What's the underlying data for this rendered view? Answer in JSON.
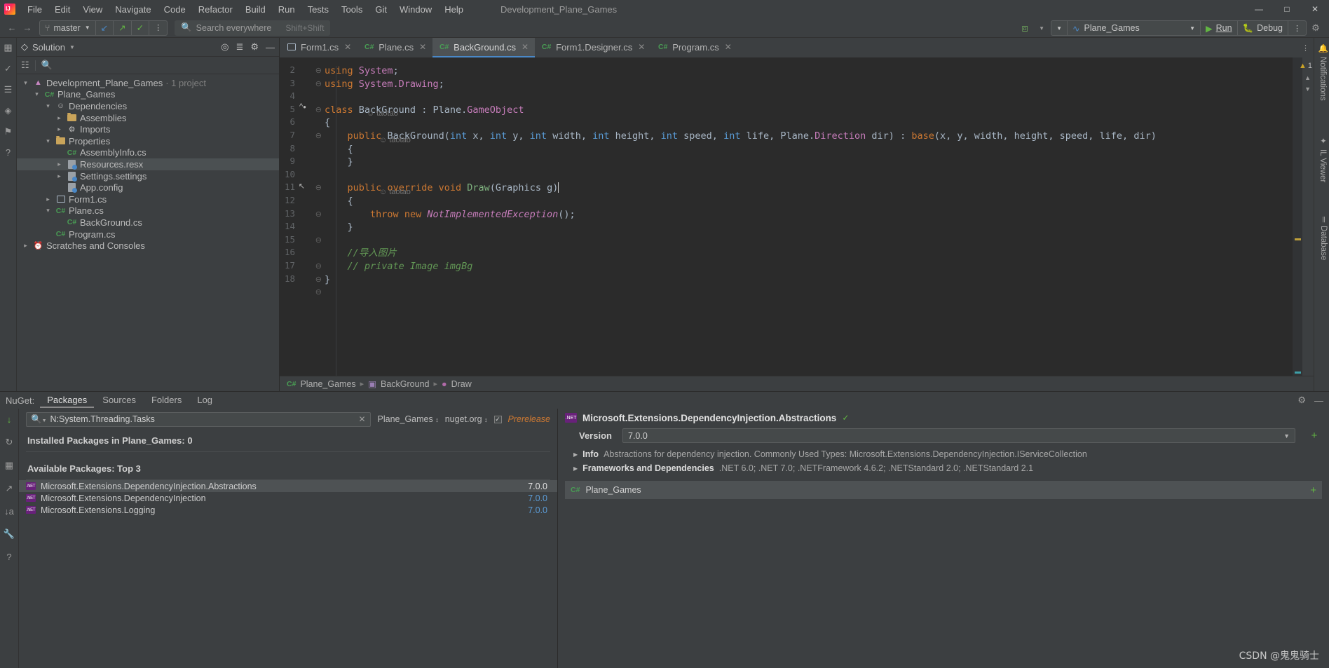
{
  "window": {
    "title": "Development_Plane_Games",
    "controls": [
      "minimize",
      "maximize",
      "close"
    ]
  },
  "menubar": {
    "items": [
      "File",
      "Edit",
      "View",
      "Navigate",
      "Code",
      "Refactor",
      "Build",
      "Run",
      "Tests",
      "Tools",
      "Git",
      "Window",
      "Help"
    ]
  },
  "toolbar": {
    "branch": "master",
    "search_placeholder": "Search everywhere",
    "search_shortcut": "Shift+Shift",
    "run_config": "Plane_Games",
    "run_label": "Run",
    "debug_label": "Debug"
  },
  "sidebar": {
    "title": "Solution",
    "tree": [
      {
        "label": "Development_Plane_Games",
        "suffix": " · 1 project",
        "indent": 0,
        "arrow": "down",
        "icon": "solution-icon",
        "selected": false
      },
      {
        "label": "Plane_Games",
        "suffix": "",
        "indent": 1,
        "arrow": "down",
        "icon": "csharp-project-icon",
        "selected": false
      },
      {
        "label": "Dependencies",
        "suffix": "",
        "indent": 2,
        "arrow": "down",
        "icon": "dependencies-icon",
        "selected": false
      },
      {
        "label": "Assemblies",
        "suffix": "",
        "indent": 3,
        "arrow": "right",
        "icon": "assemblies-icon",
        "selected": false
      },
      {
        "label": "Imports",
        "suffix": "",
        "indent": 3,
        "arrow": "right",
        "icon": "gear-icon",
        "selected": false
      },
      {
        "label": "Properties",
        "suffix": "",
        "indent": 2,
        "arrow": "down",
        "icon": "properties-folder-icon",
        "selected": false
      },
      {
        "label": "AssemblyInfo.cs",
        "suffix": "",
        "indent": 3,
        "arrow": "none",
        "icon": "csharp-file-icon",
        "selected": false
      },
      {
        "label": "Resources.resx",
        "suffix": "",
        "indent": 3,
        "arrow": "right",
        "icon": "resx-icon",
        "selected": true
      },
      {
        "label": "Settings.settings",
        "suffix": "",
        "indent": 3,
        "arrow": "right",
        "icon": "settings-icon",
        "selected": false
      },
      {
        "label": "App.config",
        "suffix": "",
        "indent": 3,
        "arrow": "none",
        "icon": "config-icon",
        "selected": false
      },
      {
        "label": "Form1.cs",
        "suffix": "",
        "indent": 2,
        "arrow": "right",
        "icon": "form-icon",
        "selected": false
      },
      {
        "label": "Plane.cs",
        "suffix": "",
        "indent": 2,
        "arrow": "down",
        "icon": "csharp-file-icon",
        "selected": false
      },
      {
        "label": "BackGround.cs",
        "suffix": "",
        "indent": 3,
        "arrow": "none",
        "icon": "csharp-file-icon",
        "selected": false
      },
      {
        "label": "Program.cs",
        "suffix": "",
        "indent": 2,
        "arrow": "none",
        "icon": "csharp-file-icon",
        "selected": false
      },
      {
        "label": "Scratches and Consoles",
        "suffix": "",
        "indent": 0,
        "arrow": "right",
        "icon": "scratches-icon",
        "selected": false
      }
    ]
  },
  "editor": {
    "tabs": [
      {
        "label": "Form1.cs",
        "icon": "form-icon",
        "active": false
      },
      {
        "label": "Plane.cs",
        "icon": "csharp-file-icon",
        "active": false
      },
      {
        "label": "BackGround.cs",
        "icon": "csharp-file-icon",
        "active": true
      },
      {
        "label": "Form1.Designer.cs",
        "icon": "csharp-file-icon",
        "active": false
      },
      {
        "label": "Program.cs",
        "icon": "csharp-file-icon",
        "active": false
      }
    ],
    "warning_count": "1",
    "code_author_lens": "taotao",
    "lines": [
      {
        "num": "2",
        "text": "using System;"
      },
      {
        "num": "3",
        "text": "using System.Drawing;"
      },
      {
        "num": "4",
        "text": ""
      },
      {
        "num": "5",
        "text": "class BackGround : Plane.GameObject"
      },
      {
        "num": "6",
        "text": "{"
      },
      {
        "num": "7",
        "text": "    public BackGround(int x, int y, int width, int height, int speed, int life, Plane.Direction dir) : base(x, y, width, height, speed, life, dir)"
      },
      {
        "num": "8",
        "text": "    {"
      },
      {
        "num": "9",
        "text": "    }"
      },
      {
        "num": "10",
        "text": ""
      },
      {
        "num": "11",
        "text": "    public override void Draw(Graphics g)"
      },
      {
        "num": "12",
        "text": "    {"
      },
      {
        "num": "13",
        "text": "        throw new NotImplementedException();"
      },
      {
        "num": "14",
        "text": "    }"
      },
      {
        "num": "15",
        "text": ""
      },
      {
        "num": "16",
        "text": "    //导入图片"
      },
      {
        "num": "17",
        "text": "    // private Image imgBg"
      },
      {
        "num": "18",
        "text": "}"
      }
    ],
    "breadcrumb": [
      "Plane_Games",
      "BackGround",
      "Draw"
    ]
  },
  "right_strip": {
    "items": [
      "Notifications",
      "IL Viewer",
      "Database"
    ]
  },
  "nuget": {
    "panel_label": "NuGet:",
    "tabs": [
      "Packages",
      "Sources",
      "Folders",
      "Log"
    ],
    "active_tab": "Packages",
    "search_value": "N:System.Threading.Tasks",
    "project_selector": "Plane_Games",
    "source_selector": "nuget.org",
    "prerelease_label": "Prerelease",
    "prerelease_checked": true,
    "installed_header": "Installed Packages in Plane_Games: 0",
    "available_header": "Available Packages: Top 3",
    "packages": [
      {
        "name": "Microsoft.Extensions.DependencyInjection.Abstractions",
        "version": "7.0.0",
        "selected": true
      },
      {
        "name": "Microsoft.Extensions.DependencyInjection",
        "version": "7.0.0",
        "selected": false
      },
      {
        "name": "Microsoft.Extensions.Logging",
        "version": "7.0.0",
        "selected": false
      }
    ],
    "detail": {
      "title": "Microsoft.Extensions.DependencyInjection.Abstractions",
      "version_label": "Version",
      "version_value": "7.0.0",
      "info_label": "Info",
      "info_text": "Abstractions for dependency injection. Commonly Used Types: Microsoft.Extensions.DependencyInjection.IServiceCollection",
      "frameworks_label": "Frameworks and Dependencies",
      "frameworks_text": ".NET 6.0; .NET 7.0; .NETFramework 4.6.2; .NETStandard 2.0; .NETStandard 2.1",
      "project_row": "Plane_Games"
    }
  },
  "watermark": "CSDN @鬼鬼骑士",
  "colors": {
    "accent_blue": "#4a88c7",
    "keyword_orange": "#cc7832",
    "string_green": "#6a8759",
    "comment_green": "#629755",
    "nuget_purple": "#68217a",
    "run_green": "#62b543"
  }
}
